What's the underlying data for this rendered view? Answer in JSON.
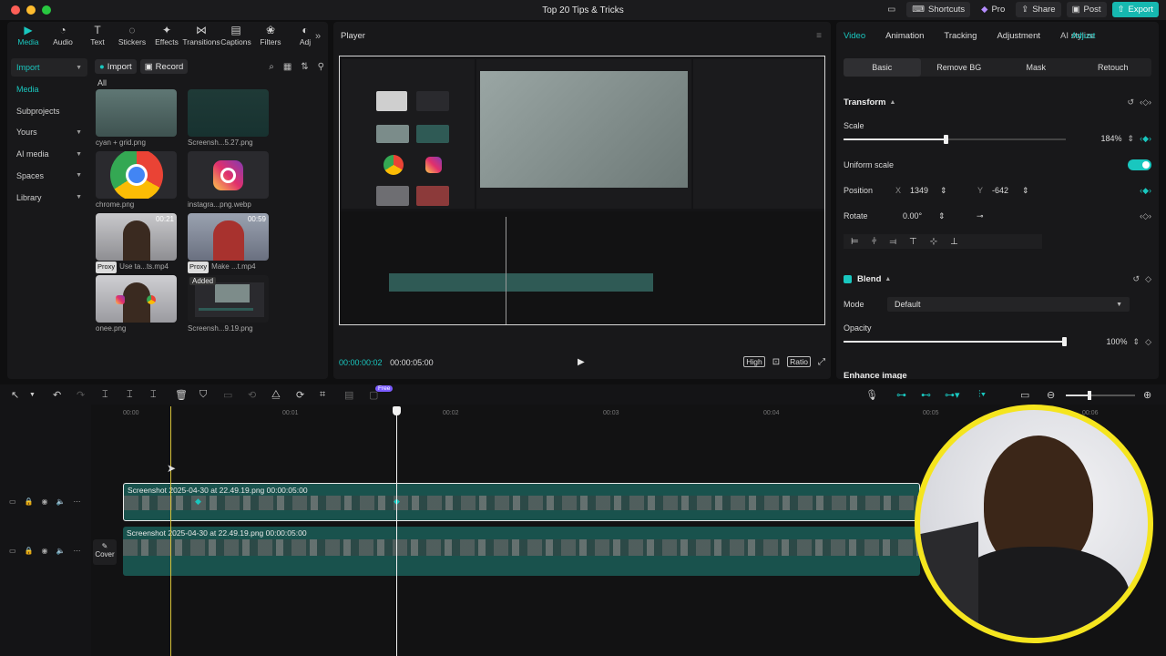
{
  "window": {
    "title": "Top 20 Tips & Tricks",
    "actions": {
      "shortcuts": "Shortcuts",
      "pro": "Pro",
      "share": "Share",
      "post": "Post",
      "export": "Export"
    }
  },
  "left": {
    "tabs": [
      {
        "label": "Media",
        "icon": "media-icon"
      },
      {
        "label": "Audio",
        "icon": "audio-icon"
      },
      {
        "label": "Text",
        "icon": "text-icon"
      },
      {
        "label": "Stickers",
        "icon": "stickers-icon"
      },
      {
        "label": "Effects",
        "icon": "effects-icon"
      },
      {
        "label": "Transitions",
        "icon": "transitions-icon"
      },
      {
        "label": "Captions",
        "icon": "captions-icon"
      },
      {
        "label": "Filters",
        "icon": "filters-icon"
      },
      {
        "label": "Adj",
        "icon": "adjust-icon"
      }
    ],
    "nav": [
      "Import",
      "Media",
      "Subprojects",
      "Yours",
      "AI media",
      "Spaces",
      "Library"
    ],
    "import_label": "Import",
    "record_label": "Record",
    "all_label": "All",
    "media": [
      {
        "name": "cyan + grid.png",
        "duration": "",
        "tag": ""
      },
      {
        "name": "Screensh...5.27.png",
        "duration": "",
        "tag": ""
      },
      {
        "name": "chrome.png",
        "duration": "",
        "tag": ""
      },
      {
        "name": "instagra...png.webp",
        "duration": "",
        "tag": ""
      },
      {
        "name": "Use ta...ts.mp4",
        "duration": "00:21",
        "tag": "Proxy"
      },
      {
        "name": "Make ...t.mp4",
        "duration": "00:59",
        "tag": "Proxy"
      },
      {
        "name": "onee.png",
        "duration": "",
        "tag": ""
      },
      {
        "name": "Screensh...9.19.png",
        "duration": "",
        "tag": "",
        "badge": "Added"
      }
    ]
  },
  "player": {
    "title": "Player",
    "current_time": "00:00:00:02",
    "total_time": "00:00:05:00",
    "quality": "High",
    "ratio": "Ratio"
  },
  "props": {
    "tabs": [
      "Video",
      "Animation",
      "Tracking",
      "Adjustment",
      "AI stylize"
    ],
    "tab_overlay": "Adjust",
    "subtabs": [
      "Basic",
      "Remove BG",
      "Mask",
      "Retouch"
    ],
    "transform_title": "Transform",
    "scale_label": "Scale",
    "scale_value": "184%",
    "scale_fraction": 0.46,
    "uniform_scale_label": "Uniform scale",
    "position_label": "Position",
    "x_label": "X",
    "x_value": "1349",
    "y_label": "Y",
    "y_value": "-642",
    "rotate_label": "Rotate",
    "rotate_value": "0.00°",
    "blend_title": "Blend",
    "mode_label": "Mode",
    "mode_value": "Default",
    "opacity_label": "Opacity",
    "opacity_value": "100%",
    "opacity_fraction": 1.0,
    "enhance_label": "Enhance image"
  },
  "timeline": {
    "ruler": [
      "00:00",
      "00:01",
      "00:02",
      "00:03",
      "00:04",
      "00:05",
      "00:06"
    ],
    "clip1": "Screenshot 2025-04-30 at 22.49.19.png   00:00:05:00",
    "clip2": "Screenshot 2025-04-30 at 22.49.19.png   00:00:05:00",
    "cover_label": "Cover",
    "free_badge": "Free"
  },
  "colors": {
    "accent": "#19c7bf",
    "clip": "#19524d",
    "webcam_ring": "#f5e51e",
    "export": "#16b8b0"
  }
}
